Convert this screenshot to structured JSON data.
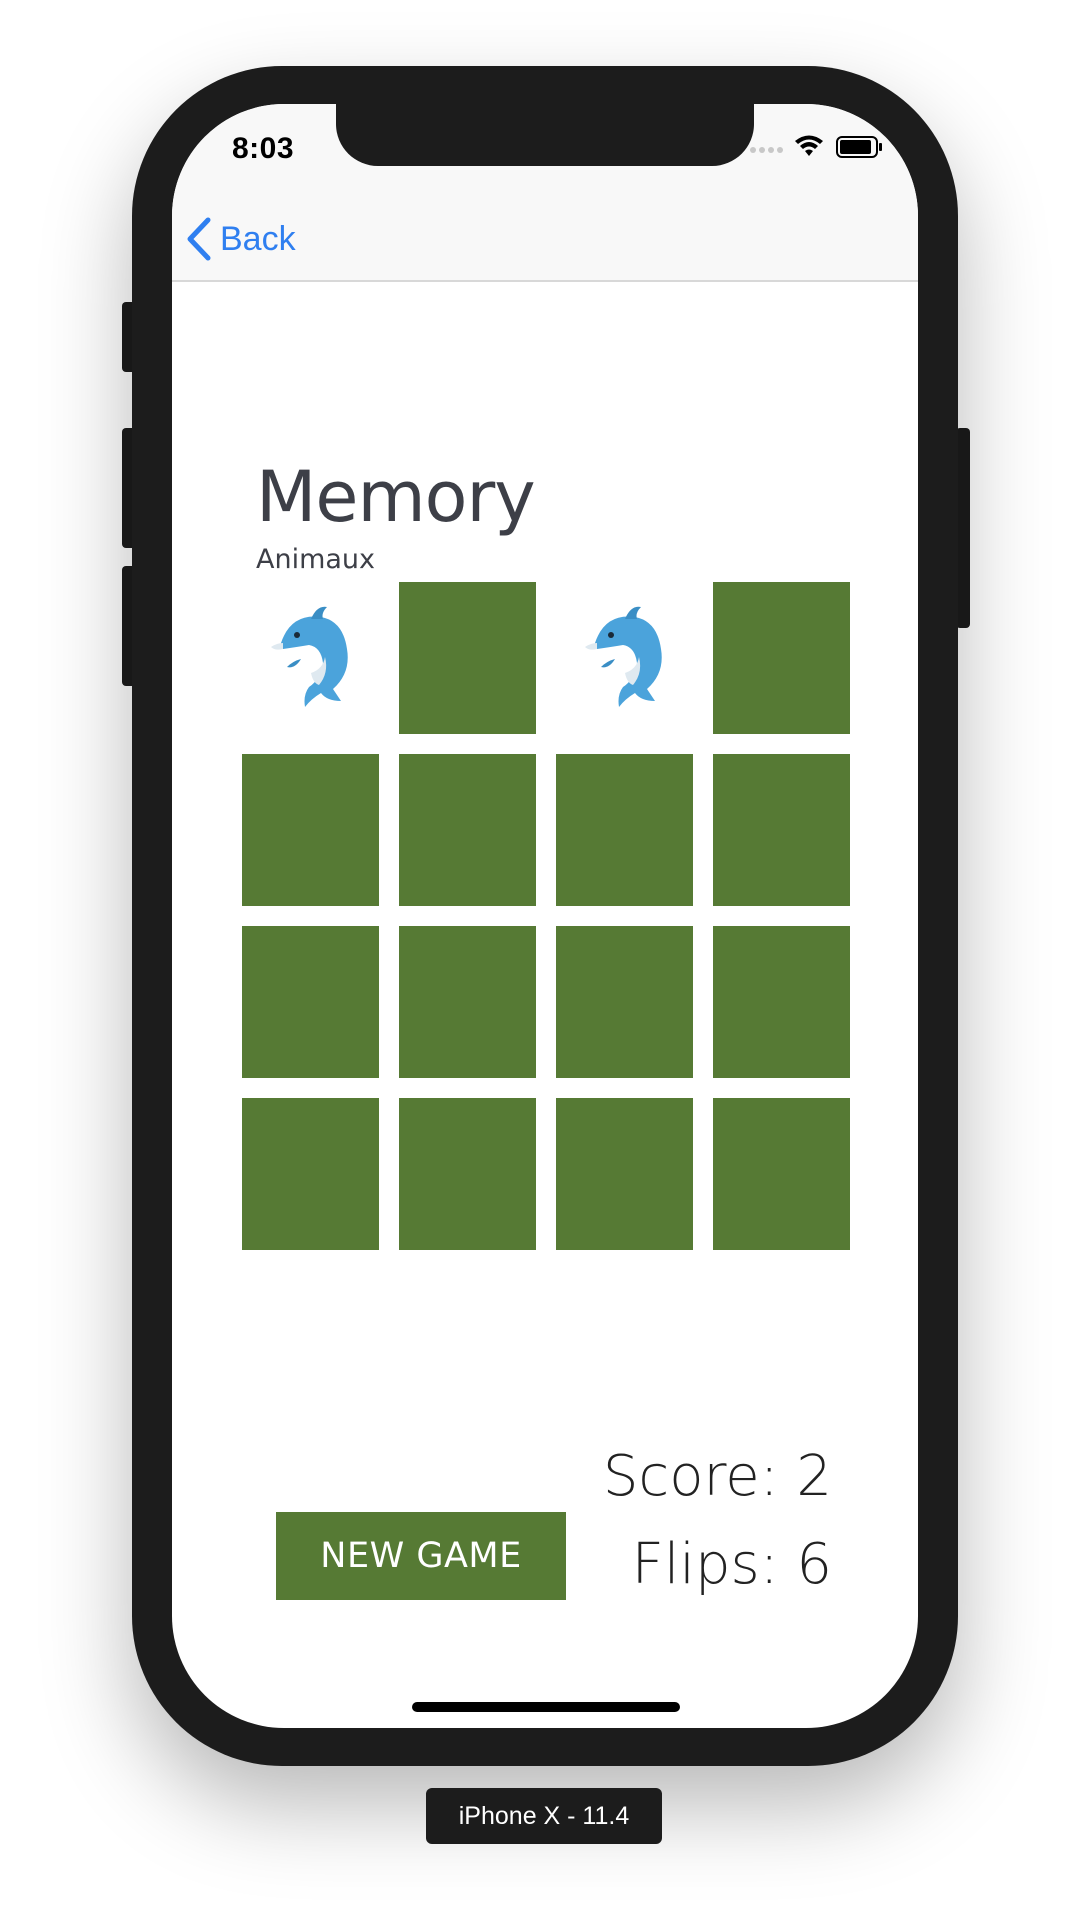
{
  "status_bar": {
    "time": "8:03",
    "icons": [
      "signal-icon",
      "wifi-icon",
      "battery-icon"
    ]
  },
  "nav": {
    "back_label": "Back",
    "back_icon": "chevron-left-icon"
  },
  "game": {
    "title": "Memory",
    "subtitle": "Animaux",
    "grid": [
      [
        "dolphin",
        "hidden",
        "dolphin",
        "hidden"
      ],
      [
        "hidden",
        "hidden",
        "hidden",
        "hidden"
      ],
      [
        "hidden",
        "hidden",
        "hidden",
        "hidden"
      ],
      [
        "hidden",
        "hidden",
        "hidden",
        "hidden"
      ]
    ],
    "new_game_label": "NEW GAME",
    "score_text": "Score: 2",
    "flips_text": "Flips: 6"
  },
  "device_label": "iPhone X - 11.4",
  "colors": {
    "card_back": "#567a34",
    "accent_link": "#2f7ff0",
    "device_frame": "#1c1c1c"
  }
}
